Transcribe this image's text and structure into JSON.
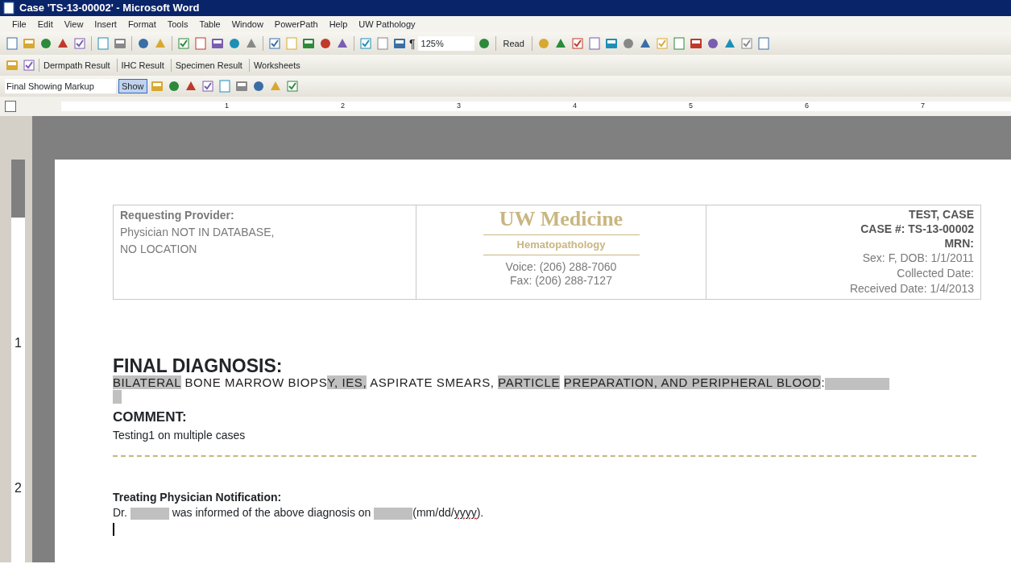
{
  "window": {
    "title": "Case 'TS-13-00002' - Microsoft Word"
  },
  "menu": [
    "File",
    "Edit",
    "View",
    "Insert",
    "Format",
    "Tools",
    "Table",
    "Window",
    "PowerPath",
    "Help",
    "UW Pathology"
  ],
  "standard_toolbar": {
    "pilcrow": "¶",
    "zoom": "125%",
    "read_button": "Read"
  },
  "powerpath_toolbar": {
    "links": [
      "Dermpath Result",
      "IHC Result",
      "Specimen Result",
      "Worksheets"
    ]
  },
  "reviewing_toolbar": {
    "display_mode": "Final Showing Markup",
    "show_button": "Show"
  },
  "ruler": {
    "labels": [
      "1",
      "2",
      "3",
      "4",
      "5",
      "6",
      "7"
    ],
    "vertical_labels": [
      "1",
      "2"
    ]
  },
  "header": {
    "provider_label": "Requesting Provider:",
    "provider_lines": [
      "Physician  NOT IN DATABASE,",
      "NO LOCATION"
    ],
    "org": "UW Medicine",
    "department": "Hematopathology",
    "phones": [
      "Voice: (206) 288-7060",
      "Fax: (206) 288-7127"
    ],
    "patient_bold": [
      "TEST, CASE",
      "CASE #:  TS-13-00002",
      "MRN:"
    ],
    "patient_lines": [
      "Sex:  F, DOB:  1/1/2011",
      "Collected Date:",
      "Received Date:  1/4/2013"
    ]
  },
  "final_diagnosis": {
    "heading": "FINAL DIAGNOSIS:",
    "segments": [
      {
        "kind": "text",
        "text": "BILATERAL",
        "shaded": true
      },
      {
        "kind": "text",
        "text": " BONE  MARROW BIOPS",
        "shaded": false
      },
      {
        "kind": "text",
        "text": "Y, IES,",
        "shaded": true
      },
      {
        "kind": "text",
        "text": " ASPIRATE SMEARS, ",
        "shaded": false
      },
      {
        "kind": "text",
        "text": "PARTICLE",
        "shaded": true
      },
      {
        "kind": "text",
        "text": "PREPARATION, ",
        "shaded": true,
        "space_before": true
      },
      {
        "kind": "text",
        "text": "AND PERIPHERAL BLOOD",
        "shaded": true,
        "space_before": true
      },
      {
        "kind": "text",
        "text": ":",
        "shaded": false
      },
      {
        "kind": "blank"
      }
    ]
  },
  "comment": {
    "heading": "COMMENT:",
    "text": "Testing1 on multiple cases"
  },
  "notification": {
    "heading": "Treating Physician Notification:",
    "segments": [
      {
        "kind": "text",
        "text": "Dr. "
      },
      {
        "kind": "blank"
      },
      {
        "kind": "text",
        "text": " was informed of the above diagnosis on "
      },
      {
        "kind": "blank"
      },
      {
        "kind": "text",
        "text": "(mm/dd/"
      },
      {
        "kind": "misspelled",
        "text": "yyyy"
      },
      {
        "kind": "text",
        "text": ")."
      }
    ]
  }
}
